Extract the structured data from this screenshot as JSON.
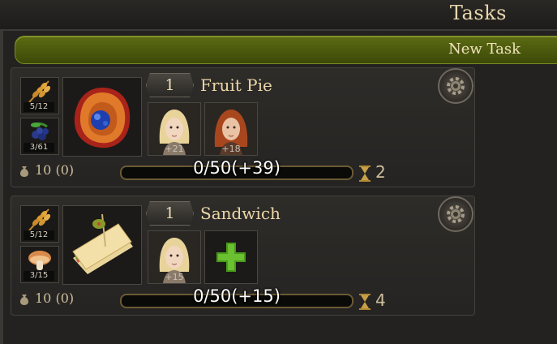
{
  "header": {
    "title": "Tasks"
  },
  "new_task": {
    "label": "New Task"
  },
  "tasks": [
    {
      "level": "1",
      "name": "Fruit Pie",
      "ingredients": [
        {
          "icon": "wheat-icon",
          "count": "5/12"
        },
        {
          "icon": "berries-icon",
          "count": "3/61"
        }
      ],
      "product_icon": "fruit-pie-icon",
      "workers": [
        {
          "icon": "blonde-worker-portrait",
          "bonus": "+21"
        },
        {
          "icon": "redhead-worker-portrait",
          "bonus": "+18"
        }
      ],
      "coins": "10 (0)",
      "progress_text": "0/50(+39)",
      "progress": 0,
      "timer": "2"
    },
    {
      "level": "1",
      "name": "Sandwich",
      "ingredients": [
        {
          "icon": "wheat-icon",
          "count": "5/12"
        },
        {
          "icon": "mushroom-icon",
          "count": "3/15"
        }
      ],
      "product_icon": "sandwich-icon",
      "workers": [
        {
          "icon": "blonde-worker-portrait",
          "bonus": "+15"
        },
        {
          "icon": "add-worker-plus-icon",
          "bonus": ""
        }
      ],
      "coins": "10 (0)",
      "progress_text": "0/50(+15)",
      "progress": 0,
      "timer": "4"
    }
  ],
  "colors": {
    "accent_green": "#5b6b12",
    "gold": "#b08a32",
    "text": "#e6d3a8"
  }
}
